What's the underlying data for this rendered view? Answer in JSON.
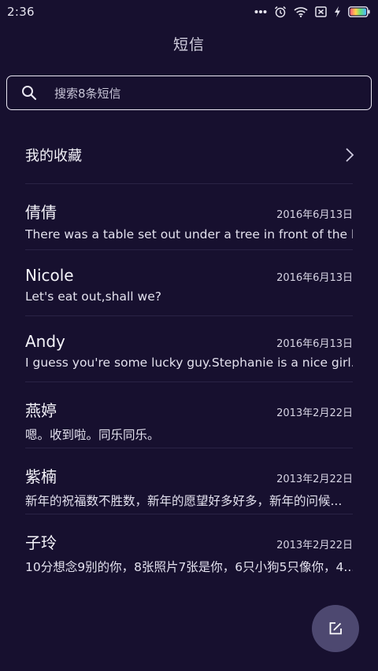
{
  "status_bar": {
    "time": "2:36",
    "icons": [
      "more-dots-icon",
      "alarm-clock-icon",
      "wifi-icon",
      "sim-none-icon",
      "charging-bolt-icon",
      "battery-icon"
    ]
  },
  "header": {
    "title": "短信"
  },
  "search": {
    "placeholder": "搜索8条短信"
  },
  "favorites": {
    "label": "我的收藏"
  },
  "messages": [
    {
      "name": "倩倩",
      "date": "2016年6月13日",
      "preview": "There was a table set out under a tree in front of the ho..."
    },
    {
      "name": "Nicole",
      "date": "2016年6月13日",
      "preview": "Let's eat out,shall we?"
    },
    {
      "name": "Andy",
      "date": "2016年6月13日",
      "preview": "I guess you're some lucky guy.Stephanie is a nice girl."
    },
    {
      "name": "燕婷",
      "date": "2013年2月22日",
      "preview": "嗯。收到啦。同乐同乐。"
    },
    {
      "name": "紫楠",
      "date": "2013年2月22日",
      "preview": "新年的祝福数不胜数，新年的愿望好多好多，新年的问候..."
    },
    {
      "name": "子玲",
      "date": "2013年2月22日",
      "preview": "10分想念9别的你，8张照片7张是你，6只小狗5只像你，4..."
    }
  ],
  "fab": {
    "icon": "compose-icon"
  },
  "colors": {
    "background": "#17102f",
    "fab": "#4d4870",
    "divider": "#2a2345"
  }
}
